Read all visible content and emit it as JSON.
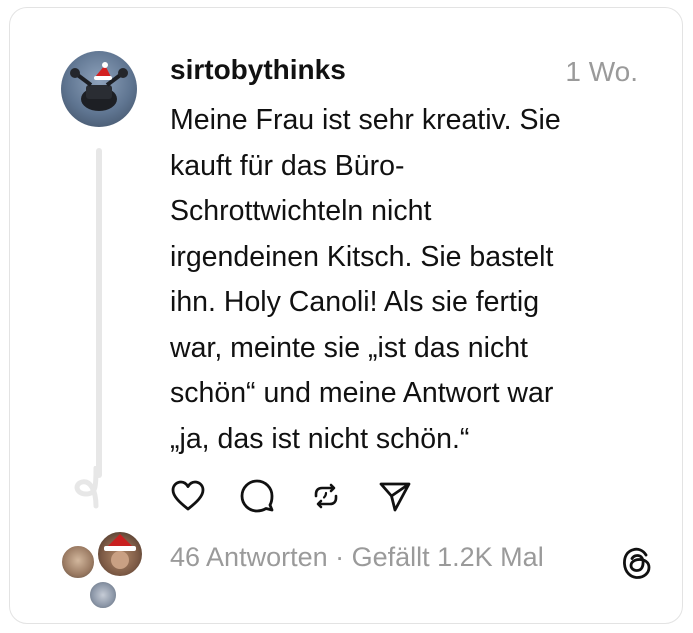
{
  "post": {
    "username": "sirtobythinks",
    "time": "1 Wo.",
    "text_lines": [
      "Meine Frau ist sehr kreativ. Sie",
      "kauft für das Büro-",
      "Schrottwichteln nicht",
      "irgendeinen Kitsch. Sie bastelt",
      "ihn. Holy Canoli! Als sie fertig",
      "war, meinte sie „ist das nicht",
      "schön“ und meine Antwort war",
      "„ja, das ist nicht schön.“"
    ]
  },
  "footer": {
    "stats": "46 Antworten · Gefällt 1.2K Mal"
  },
  "icons": {
    "like": "heart-icon",
    "reply": "comment-icon",
    "repost": "repost-icon",
    "share": "send-icon",
    "brand": "threads-logo-icon"
  },
  "colors": {
    "text": "#111111",
    "muted": "#9a9a9a",
    "border": "#e3e3e3"
  }
}
